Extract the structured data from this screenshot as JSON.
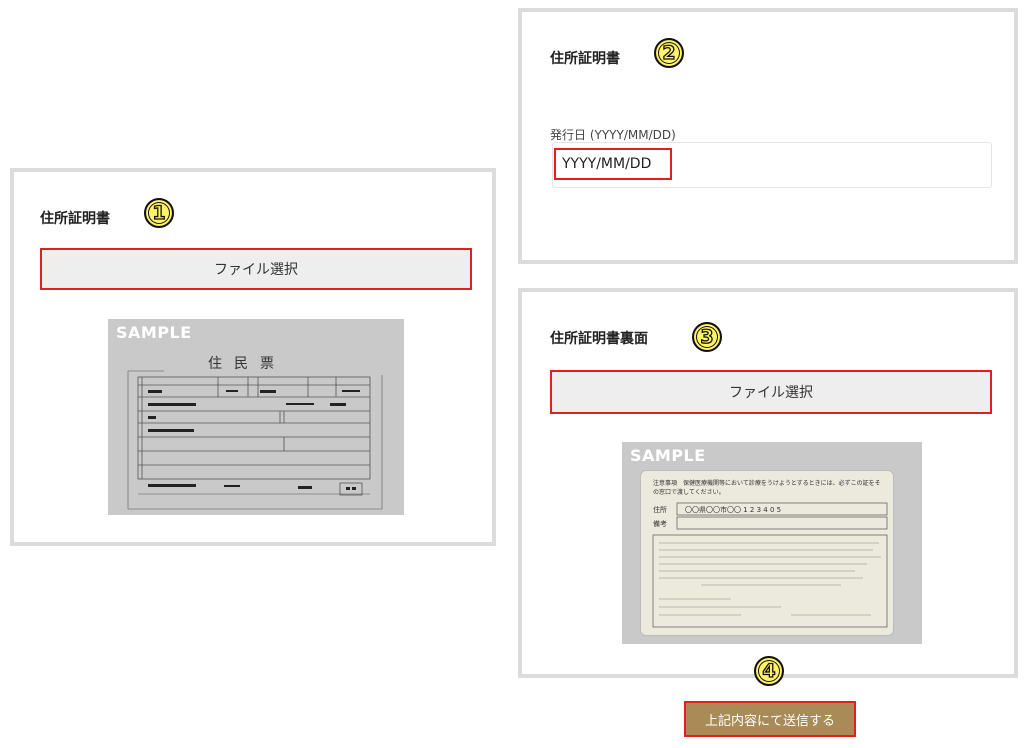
{
  "panels": {
    "address_cert_front": {
      "title": "住所証明書",
      "badge": "1",
      "file_button": "ファイル選択",
      "sample_label": "SAMPLE",
      "doc_title": "住民票"
    },
    "issue_date": {
      "title": "住所証明書",
      "badge": "2",
      "date_label": "発行日 (YYYY/MM/DD)",
      "date_placeholder": "YYYY/MM/DD"
    },
    "address_cert_back": {
      "title": "住所証明書裏面",
      "badge": "3",
      "file_button": "ファイル選択",
      "sample_label": "SAMPLE",
      "card_notice": "注意事項　保健医療機関等において診療をうけようとするときには、必ずこの証をその窓口で渡してください。",
      "card_address_label": "住所",
      "card_address_value": "〇〇県〇〇市〇〇 1 2 3 4 0 5",
      "card_remarks_label": "備考"
    }
  },
  "submit": {
    "badge": "4",
    "label": "上記内容にて送信する"
  },
  "colors": {
    "highlight_border": "#e01f1f",
    "submit_bg": "#a88b57",
    "panel_border": "#dcdcdc",
    "badge_fill": "#fff36a"
  }
}
